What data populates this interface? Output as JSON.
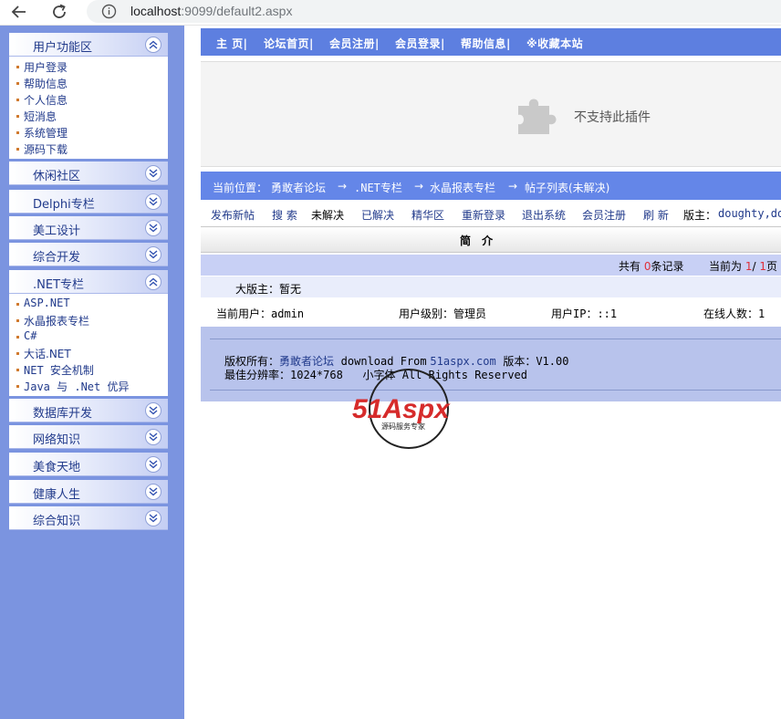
{
  "browser": {
    "url_host": "localhost",
    "url_path": ":9099/default2.aspx"
  },
  "sidebar": {
    "sections": [
      {
        "title": "用户功能区",
        "expanded": true,
        "items": [
          "用户登录",
          "帮助信息",
          "个人信息",
          "短消息",
          "系统管理",
          "源码下载"
        ]
      },
      {
        "title": "休闲社区",
        "expanded": false
      },
      {
        "title": "Delphi专栏",
        "expanded": false
      },
      {
        "title": "美工设计",
        "expanded": false
      },
      {
        "title": "综合开发",
        "expanded": false
      },
      {
        "title": ".NET专栏",
        "expanded": true,
        "items": [
          "ASP.NET",
          "水晶报表专栏",
          "C#",
          "大话.NET",
          "NET 安全机制",
          "Java 与 .Net 优异"
        ]
      },
      {
        "title": "数据库开发",
        "expanded": false
      },
      {
        "title": "网络知识",
        "expanded": false
      },
      {
        "title": "美食天地",
        "expanded": false
      },
      {
        "title": "健康人生",
        "expanded": false
      },
      {
        "title": "综合知识",
        "expanded": false
      }
    ]
  },
  "top_nav": [
    "主 页|",
    "论坛首页|",
    "会员注册|",
    "会员登录|",
    "帮助信息|",
    "※收藏本站"
  ],
  "plugin": {
    "message": "不支持此插件"
  },
  "location": {
    "label": "当前位置：",
    "parts": [
      "勇敢者论坛",
      "→",
      ".NET专栏",
      "→",
      "水晶报表专栏",
      "→",
      "帖子列表(未解决)"
    ]
  },
  "toolbar": {
    "items": [
      "发布新帖",
      "搜 索",
      "未解决",
      "已解决",
      "精华区",
      "重新登录",
      "退出系统",
      "会员注册",
      "刷 新"
    ],
    "moderator_label": "版主：",
    "moderator_names": "doughty,do"
  },
  "intro": {
    "title": "简 介"
  },
  "record_bar": {
    "prefix": "共有",
    "count": "0",
    "suffix": "条记录",
    "page_prefix": "当前为",
    "page_current": "1",
    "page_sep": "/",
    "page_total": "1",
    "page_suffix": "页"
  },
  "moderator_row": {
    "text": "大版主：暂无"
  },
  "user_row": {
    "current_user": "当前用户：admin",
    "user_level": "用户级别：管理员",
    "user_ip": "用户IP：::1",
    "online": "在线人数：1"
  },
  "footer": {
    "copyright_label": "版权所有：",
    "site_name": "勇敢者论坛",
    "download_from": "download From",
    "download_site": "51aspx.com",
    "version": "版本：V1.00",
    "resolution": "最佳分辨率：1024*768",
    "rights": "小字体 All Rights Reserved"
  },
  "watermark": {
    "brand": "51Aspx",
    "slogan": "源码服务专家"
  },
  "colors": {
    "sidebar_bg": "#7b94e0",
    "nav_bg": "#5d7fe0",
    "link": "#213a8b",
    "accent_red": "#e0303a"
  }
}
